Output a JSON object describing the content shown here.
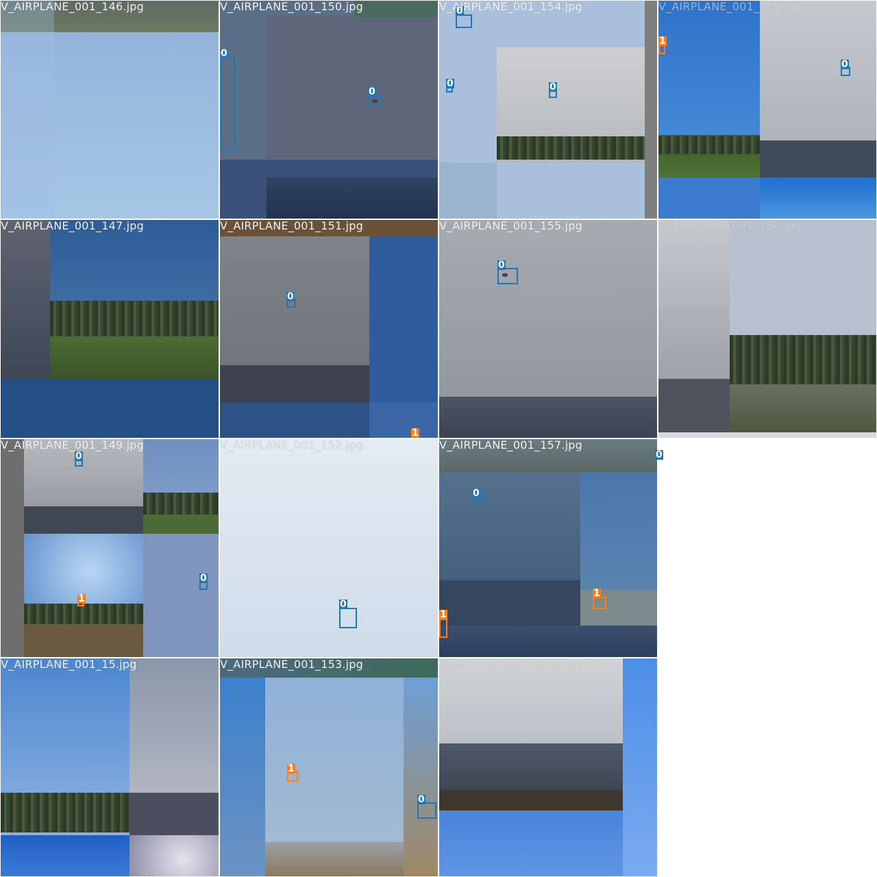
{
  "classes": {
    "0": {
      "label": "0",
      "color": "#1f77b4"
    },
    "1": {
      "label": "1",
      "color": "#ff7f0e"
    }
  },
  "tiles": [
    {
      "filename": "V_AIRPLANE_001_146.jpg",
      "boxes": []
    },
    {
      "filename": "V_AIRPLANE_001_150.jpg",
      "boxes": [
        {
          "cls": "0"
        },
        {
          "cls": "0"
        }
      ]
    },
    {
      "filename": "V_AIRPLANE_001_154.jpg",
      "boxes": [
        {
          "cls": "0"
        },
        {
          "cls": "0"
        },
        {
          "cls": "0"
        }
      ]
    },
    {
      "filename": "V_AIRPLANE_001_159.jpg",
      "boxes": [
        {
          "cls": "1"
        },
        {
          "cls": "0"
        }
      ]
    },
    {
      "filename": "V_AIRPLANE_001_147.jpg",
      "boxes": []
    },
    {
      "filename": "V_AIRPLANE_001_151.jpg",
      "boxes": [
        {
          "cls": "0"
        },
        {
          "cls": "1"
        }
      ]
    },
    {
      "filename": "V_AIRPLANE_001_155.jpg",
      "boxes": [
        {
          "cls": "0"
        }
      ]
    },
    {
      "filename": "V_AIRPLANE_001_160.jpg",
      "boxes": []
    },
    {
      "filename": "V_AIRPLANE_001_149.jpg",
      "boxes": [
        {
          "cls": "0"
        },
        {
          "cls": "1"
        },
        {
          "cls": "0"
        }
      ]
    },
    {
      "filename": "V_AIRPLANE_001_152.jpg",
      "boxes": [
        {
          "cls": "0"
        }
      ]
    },
    {
      "filename": "V_AIRPLANE_001_157.jpg",
      "boxes": [
        {
          "cls": "0"
        },
        {
          "cls": "1"
        },
        {
          "cls": "1"
        },
        {
          "cls": "0"
        }
      ]
    },
    {
      "filename": "V_AIRPLANE_001_15.jpg",
      "boxes": []
    },
    {
      "filename": "V_AIRPLANE_001_153.jpg",
      "boxes": [
        {
          "cls": "1"
        },
        {
          "cls": "0"
        }
      ]
    },
    {
      "filename": "V_AIRPLANE_001_158.jpg",
      "boxes": []
    }
  ]
}
